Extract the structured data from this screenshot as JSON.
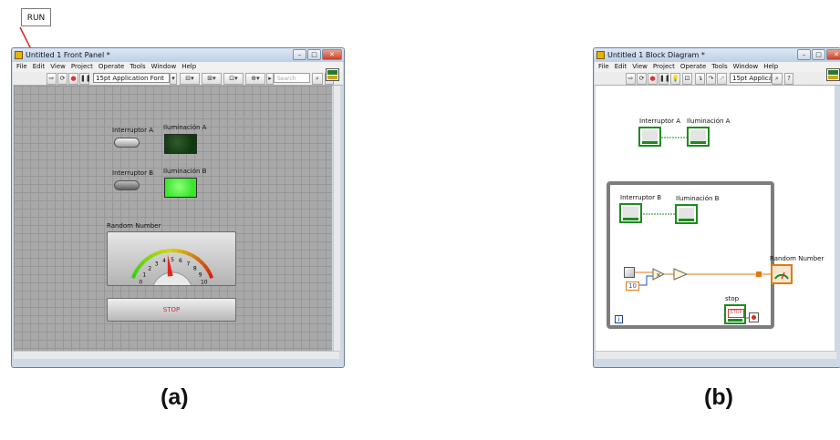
{
  "annotation": {
    "run_label": "RUN"
  },
  "front_panel": {
    "title": "Untitled 1 Front Panel *",
    "menu": [
      "File",
      "Edit",
      "View",
      "Project",
      "Operate",
      "Tools",
      "Window",
      "Help"
    ],
    "font_selector": "15pt Application Font",
    "search_placeholder": "Search",
    "controls": {
      "switch_a": "Interruptor A",
      "switch_b": "Interruptor B",
      "led_a": "Iluminación A",
      "led_b": "Iluminación B",
      "gauge": "Random Number",
      "gauge_ticks": [
        "0",
        "1",
        "2",
        "3",
        "4",
        "5",
        "6",
        "7",
        "8",
        "9",
        "10"
      ],
      "gauge_value": 4.5,
      "stop_button": "STOP"
    },
    "colors": {
      "led_a_off": "#0d3a0d",
      "led_b_on": "#39e62a",
      "stop_text": "#e2261d",
      "needle": "#e2261d"
    }
  },
  "block_diagram": {
    "title": "Untitled 1 Block Diagram *",
    "menu": [
      "File",
      "Edit",
      "View",
      "Project",
      "Operate",
      "Tools",
      "Window",
      "Help"
    ],
    "font_selector": "15pt Applica",
    "nodes": {
      "switch_a": "Interruptor A",
      "led_a": "Iluminación A",
      "switch_b": "Interruptor B",
      "led_b": "Iluminación B",
      "random_number": "Random Number",
      "constant": "10",
      "stop": "stop",
      "stop_terminal": "STOP",
      "loop_index": "i"
    }
  },
  "captions": {
    "a": "(a)",
    "b": "(b)"
  }
}
